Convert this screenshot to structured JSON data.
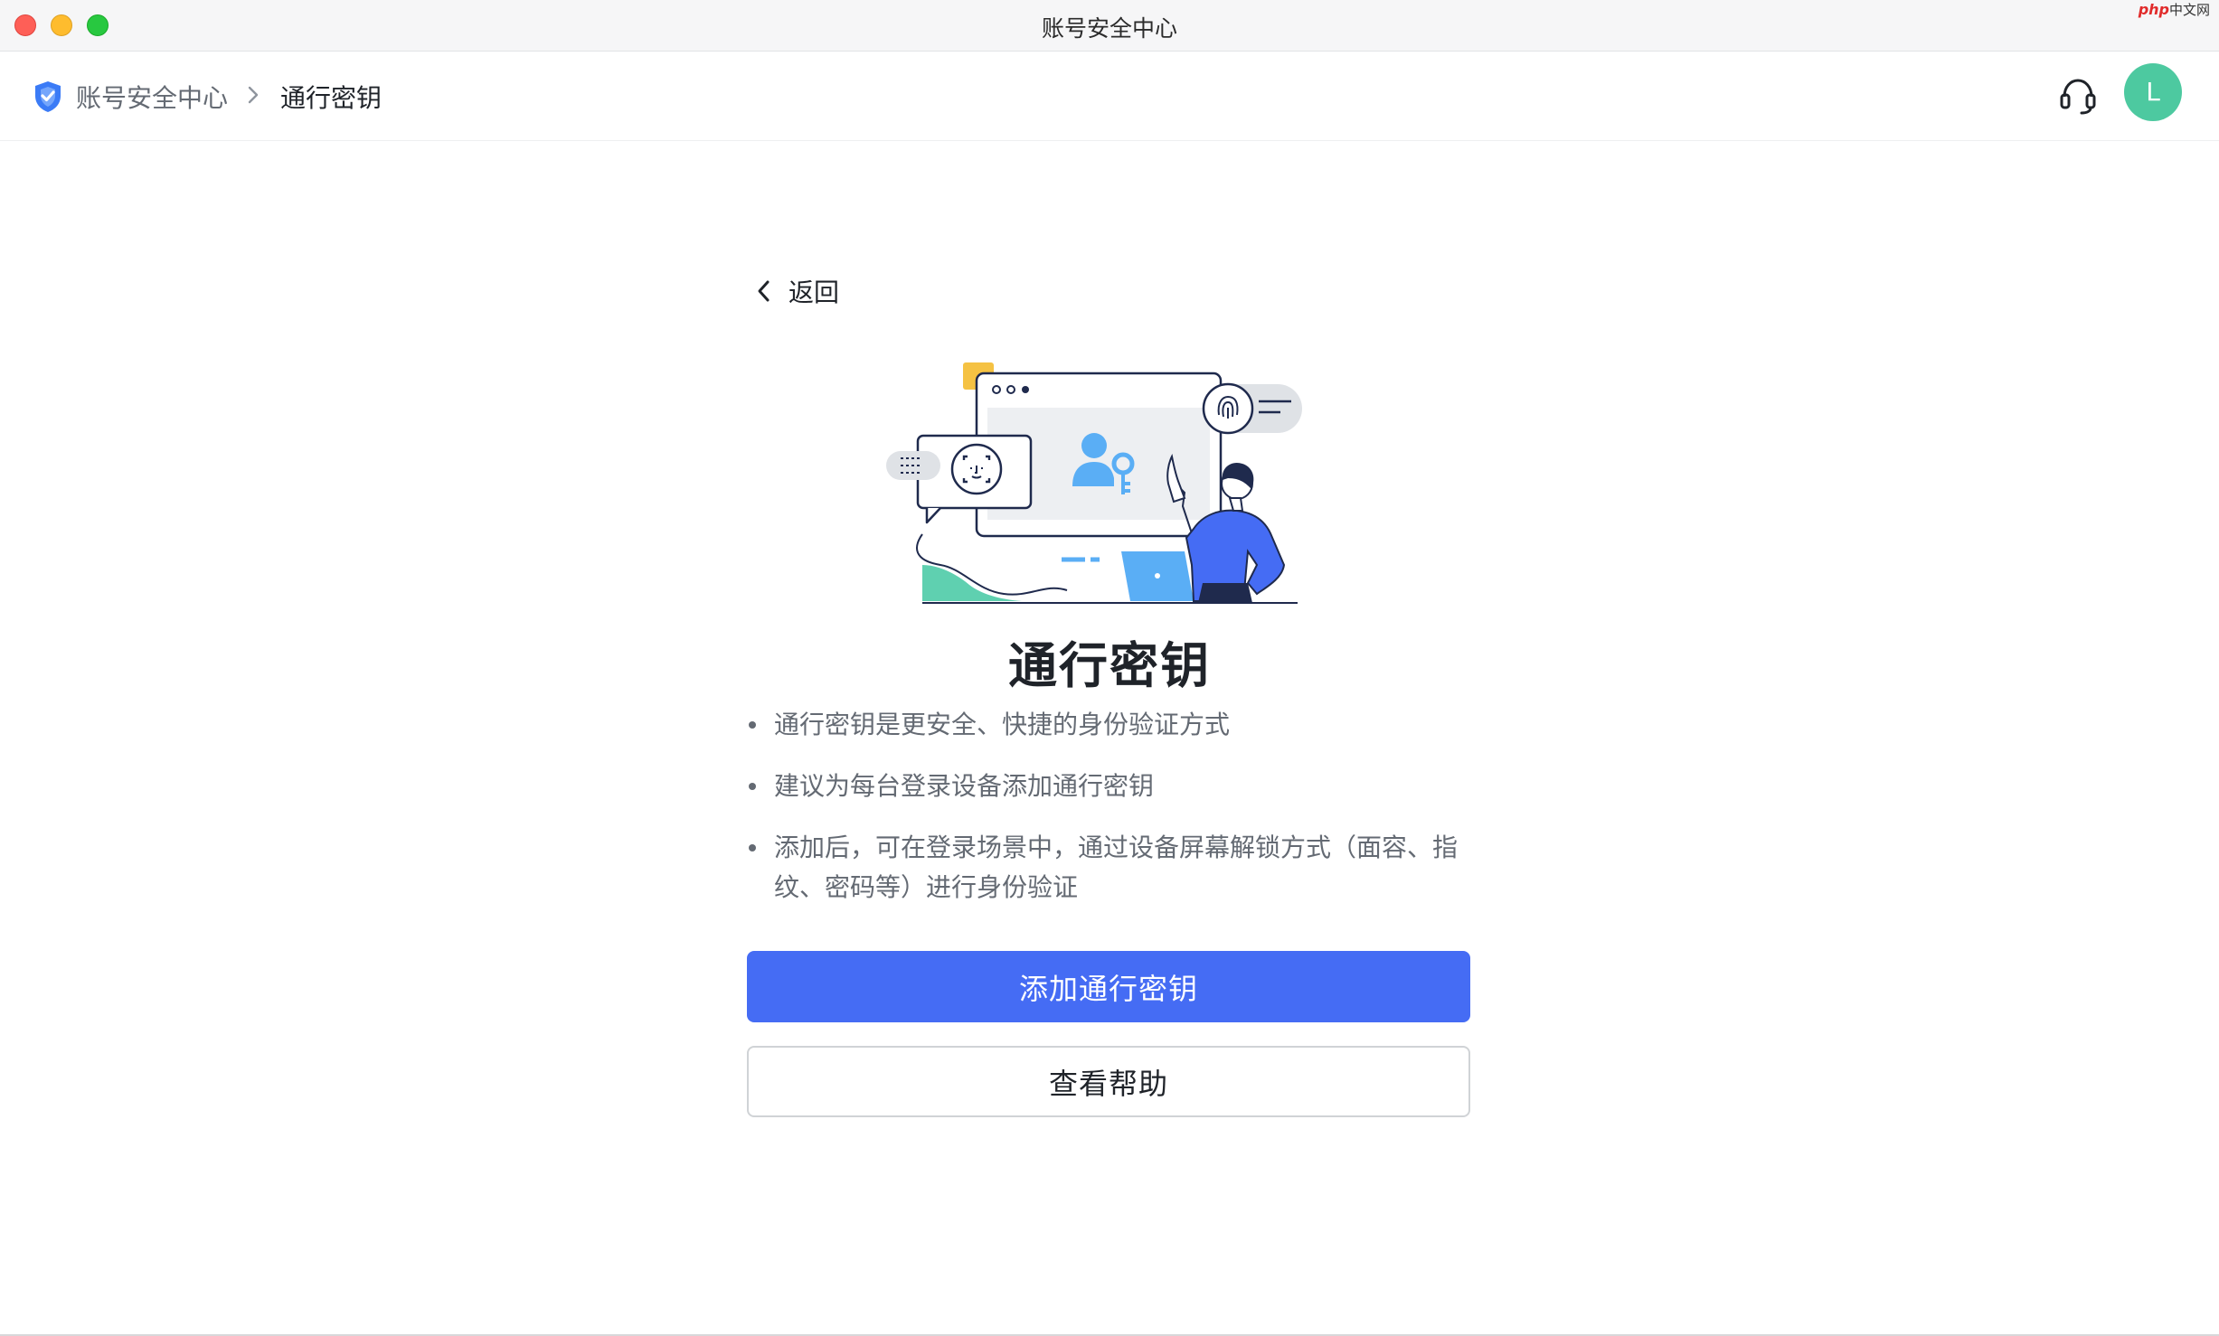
{
  "window": {
    "title": "账号安全中心",
    "watermark_brand": "php",
    "watermark_text": "中文网"
  },
  "breadcrumb": {
    "home_label": "账号安全中心",
    "current_label": "通行密钥"
  },
  "header": {
    "avatar_initial": "L",
    "support_icon": "headset-icon"
  },
  "main": {
    "back_label": "返回",
    "title": "通行密钥",
    "bullets": [
      "通行密钥是更安全、快捷的身份验证方式",
      "建议为每台登录设备添加通行密钥",
      "添加后，可在登录场景中，通过设备屏幕解锁方式（面容、指纹、密码等）进行身份验证"
    ],
    "primary_button": "添加通行密钥",
    "secondary_button": "查看帮助"
  },
  "colors": {
    "accent": "#456cf4",
    "avatar": "#4dc9a0",
    "shield": "#3b7bf6",
    "illustration_blue": "#5aaef5",
    "illustration_green": "#5fd0b0",
    "illustration_yellow": "#f5c243"
  }
}
